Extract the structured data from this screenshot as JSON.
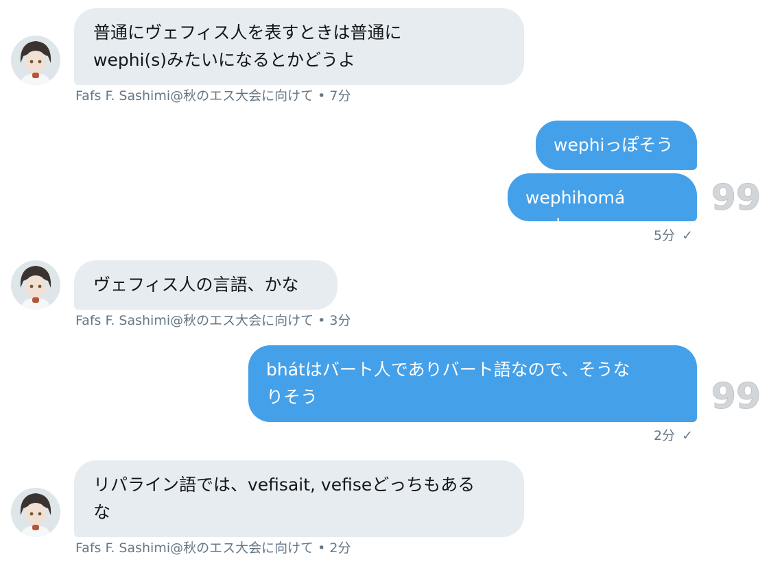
{
  "messages": [
    {
      "text": "普通にヴェフィス人を表すときは普通に\nwephi(s)みたいになるとかどうよ",
      "meta": "Fafs F. Sashimi@秋のエス大会に向けて • 7分"
    },
    {
      "text": "wephiっぽそう"
    },
    {
      "text": "wephihomá zepha",
      "time": "5分",
      "check": "✓"
    },
    {
      "text": "ヴェフィス人の言語、かな",
      "meta": "Fafs F. Sashimi@秋のエス大会に向けて • 3分"
    },
    {
      "text": "bhátはバート人でありバート語なので、そうな\nりそう",
      "time": "2分",
      "check": "✓"
    },
    {
      "text": "リパライン語では、vefisait, vefiseどっちもある\nな",
      "meta": "Fafs F. Sashimi@秋のエス大会に向けて • 2分"
    }
  ],
  "receipt": {
    "label": "99"
  },
  "colors": {
    "incoming": "#e6ecf0",
    "outgoing": "#44a0e9",
    "meta": "#657786"
  }
}
